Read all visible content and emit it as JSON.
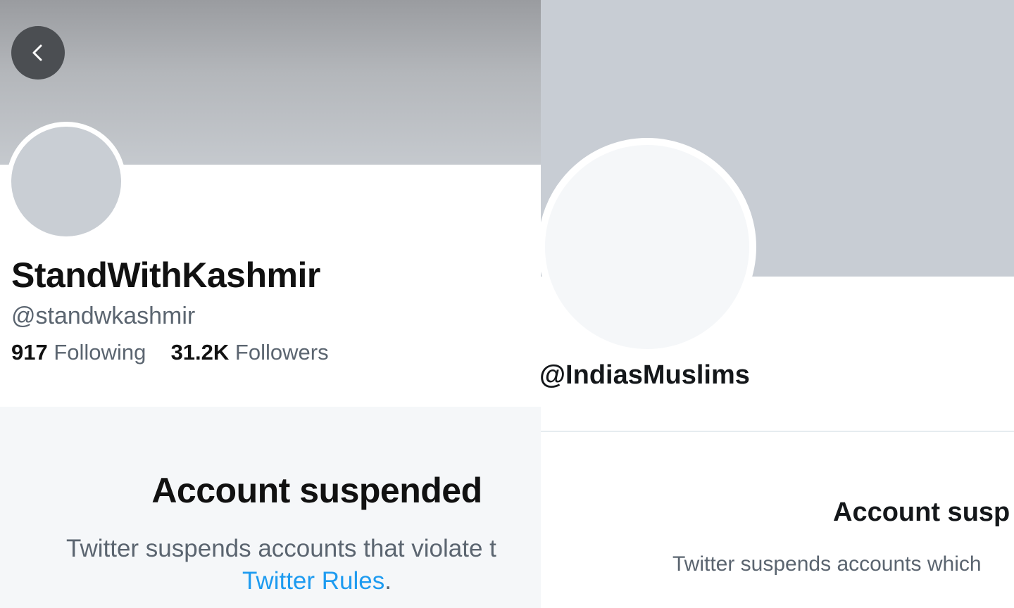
{
  "left_profile": {
    "display_name": "StandWithKashmir",
    "handle": "@standwkashmir",
    "following_count": "917",
    "following_label": "Following",
    "followers_count": "31.2K",
    "followers_label": "Followers",
    "back_icon": "chevron-left-icon",
    "suspended_title": "Account suspended",
    "suspended_text": "Twitter suspends accounts that violate t",
    "rules_link": "Twitter Rules",
    "rules_period": ".",
    "colors": {
      "link": "#1d9bf0",
      "back_button": "#4b4e52",
      "banner": "#b4b7bb"
    }
  },
  "right_profile": {
    "handle": "@IndiasMuslims",
    "suspended_title": "Account susp",
    "suspended_text": "Twitter suspends accounts which",
    "colors": {
      "banner": "#c8cdd4"
    }
  }
}
